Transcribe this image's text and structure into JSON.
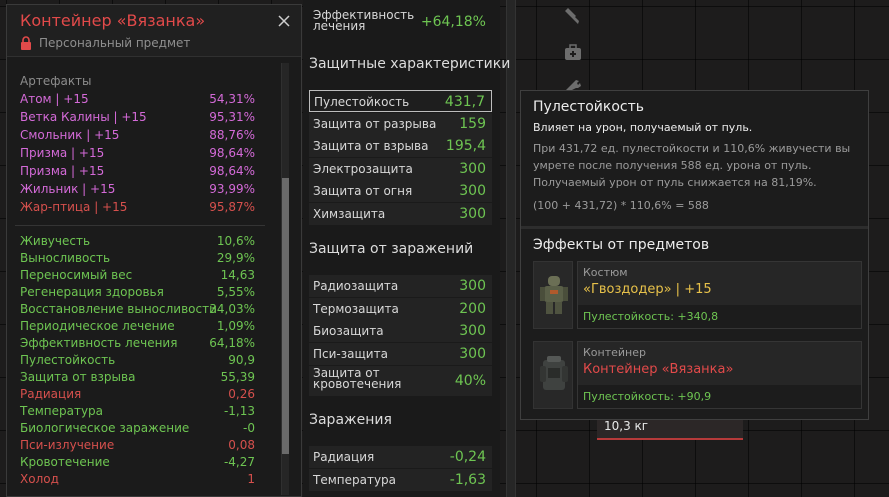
{
  "background": {
    "weight": "10,3 кг",
    "icons": [
      "flashlight-icon",
      "medkit-icon",
      "wrench-icon"
    ]
  },
  "item_panel": {
    "title": "Контейнер «Вязанка»",
    "subtitle": "Персональный предмет",
    "artifacts_header": "Артефакты",
    "artifacts": [
      {
        "label": "Атом | +15",
        "value": "54,31%"
      },
      {
        "label": "Ветка Калины | +15",
        "value": "95,31%"
      },
      {
        "label": "Смольник | +15",
        "value": "88,76%"
      },
      {
        "label": "Призма | +15",
        "value": "98,64%"
      },
      {
        "label": "Призма | +15",
        "value": "98,64%"
      },
      {
        "label": "Жильник | +15",
        "value": "93,99%"
      },
      {
        "label": "Жар-птица | +15",
        "value": "95,87%"
      }
    ],
    "stats": [
      {
        "label": "Живучесть",
        "value": "10,6%",
        "color": "green"
      },
      {
        "label": "Выносливость",
        "value": "29,9%",
        "color": "green"
      },
      {
        "label": "Переносимый вес",
        "value": "14,63",
        "color": "green"
      },
      {
        "label": "Регенерация здоровья",
        "value": "5,55%",
        "color": "green"
      },
      {
        "label": "Восстановление выносливости",
        "value": "34,03%",
        "color": "green"
      },
      {
        "label": "Периодическое лечение",
        "value": "1,09%",
        "color": "green"
      },
      {
        "label": "Эффективность лечения",
        "value": "64,18%",
        "color": "green"
      },
      {
        "label": "Пулестойкость",
        "value": "90,9",
        "color": "green"
      },
      {
        "label": "Защита от взрыва",
        "value": "55,39",
        "color": "green"
      },
      {
        "label": "Радиация",
        "value": "0,26",
        "color": "red"
      },
      {
        "label": "Температура",
        "value": "-1,13",
        "color": "green"
      },
      {
        "label": "Биологическое заражение",
        "value": "-0",
        "color": "green"
      },
      {
        "label": "Пси-излучение",
        "value": "0,08",
        "color": "red"
      },
      {
        "label": "Кровотечение",
        "value": "-4,27",
        "color": "green"
      },
      {
        "label": "Холод",
        "value": "1",
        "color": "red"
      }
    ]
  },
  "stats_panel": {
    "top_row": {
      "label_line1": "Эффективность",
      "label_line2": "лечения",
      "value": "+64,18%"
    },
    "sections": [
      {
        "title": "Защитные характеристики",
        "rows": [
          {
            "label": "Пулестойкость",
            "value": "431,7"
          },
          {
            "label": "Защита от разрыва",
            "value": "159"
          },
          {
            "label": "Защита от взрыва",
            "value": "195,4"
          },
          {
            "label": "Электрозащита",
            "value": "300"
          },
          {
            "label": "Защита от огня",
            "value": "300"
          },
          {
            "label": "Химзащита",
            "value": "300"
          }
        ]
      },
      {
        "title": "Защита от заражений",
        "rows": [
          {
            "label": "Радиозащита",
            "value": "300"
          },
          {
            "label": "Термозащита",
            "value": "200"
          },
          {
            "label": "Биозащита",
            "value": "300"
          },
          {
            "label": "Пси-защита",
            "value": "300"
          },
          {
            "label": "Защита от кровотечения",
            "label_line1": "Защита от",
            "label_line2": "кровотечения",
            "value": "40%"
          }
        ]
      },
      {
        "title": "Заражения",
        "rows": [
          {
            "label": "Радиация",
            "value": "-0,24"
          },
          {
            "label": "Температура",
            "value": "-1,63"
          }
        ]
      }
    ]
  },
  "tooltip": {
    "title": "Пулестойкость",
    "subtitle": "Влияет на урон, получаемый от пуль.",
    "desc_line1": "При 431,72 ед. пулестойкости и 110,6% живучести вы",
    "desc_line2": "умрете после получения 588 ед. урона от пуль.",
    "desc_line3": "Получаемый урон от пуль снижается на 81,19%.",
    "formula": "(100 + 431,72) * 110,6% = 588",
    "effects_header": "Эффекты от предметов",
    "effects": [
      {
        "kind": "Костюм",
        "name": "«Гвоздодер» | +15",
        "stat": "Пулестойкость: +340,8",
        "name_color": "#e8c24a",
        "icon": "suit-icon"
      },
      {
        "kind": "Контейнер",
        "name": "Контейнер «Вязанка»",
        "stat": "Пулестойкость: +90,9",
        "name_color": "#e24a4a",
        "icon": "container-icon"
      }
    ]
  },
  "colors": {
    "green": "#6ec552",
    "red": "#d6504d",
    "pink": "#d46ad8",
    "title_red": "#e24a4a",
    "gold": "#e8c24a"
  }
}
